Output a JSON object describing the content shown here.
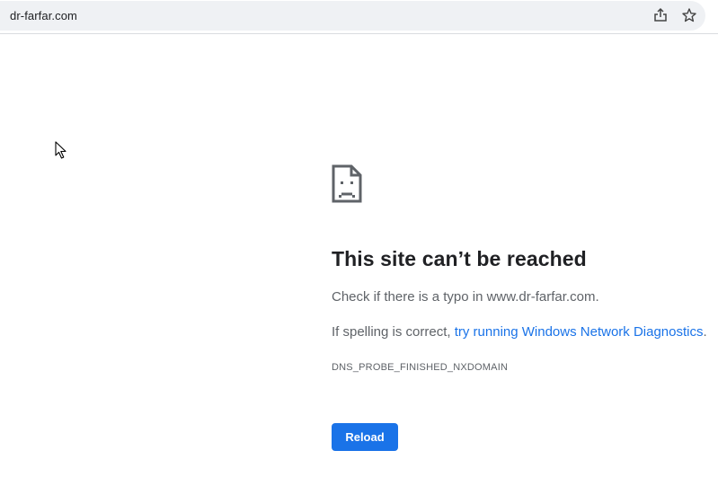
{
  "address_bar": {
    "url": "dr-farfar.com",
    "icons": [
      "site-info-icon",
      "share-icon",
      "bookmark-star-icon"
    ]
  },
  "error_page": {
    "icon": "sad-page-icon",
    "title": "This site can’t be reached",
    "suggestion_typo": "Check if there is a typo in www.dr-farfar.com.",
    "suggestion_spelling_prefix": "If spelling is correct, ",
    "diagnostics_link": "try running Windows Network Diagnostics",
    "suggestion_spelling_suffix": ".",
    "error_code": "DNS_PROBE_FINISHED_NXDOMAIN",
    "reload_label": "Reload"
  },
  "colors": {
    "accent": "#1a73e8",
    "title_text": "#202124",
    "body_text": "#5f6368",
    "omnibox_bg": "#eff1f4"
  }
}
